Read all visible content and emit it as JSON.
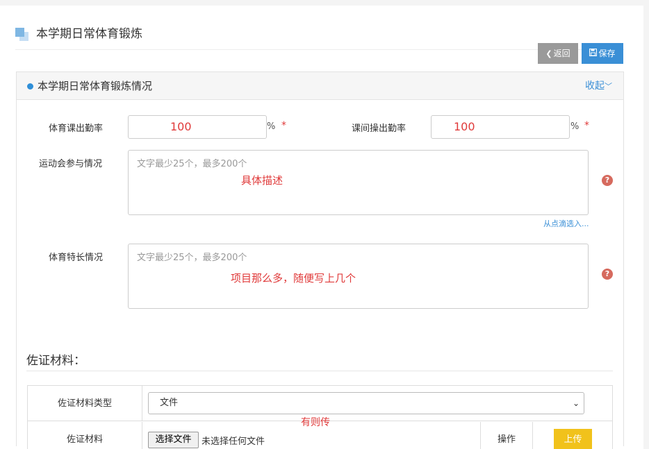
{
  "header": {
    "title": "本学期日常体育锻炼",
    "back_label": "返回",
    "save_label": "保存"
  },
  "panel": {
    "title": "本学期日常体育锻炼情况",
    "collapse_label": "收起",
    "fields": {
      "pe_attendance": {
        "label": "体育课出勤率",
        "value": "100",
        "unit": "%",
        "required": "*"
      },
      "exercise_attendance": {
        "label": "课间操出勤率",
        "value": "100",
        "unit": "%",
        "required": "*"
      },
      "sports_meet": {
        "label": "运动会参与情况",
        "placeholder": "文字最少25个，最多200个",
        "note": "具体描述",
        "pick_link": "从点滴选入..."
      },
      "sports_specialty": {
        "label": "体育特长情况",
        "placeholder": "文字最少25个，最多200个",
        "note": "项目那么多，随便写上几个"
      }
    }
  },
  "evidence": {
    "section_title": "佐证材料：",
    "type_label": "佐证材料类型",
    "type_selected": "文件",
    "material_label": "佐证材料",
    "choose_file_label": "选择文件",
    "no_file_label": "未选择任何文件",
    "operation_label": "操作",
    "upload_label": "上传",
    "note": "有则传"
  },
  "icons": {
    "back": "chevron-left-icon",
    "save": "floppy-icon",
    "help": "question-circle-icon",
    "collapse": "chevron-down-icon"
  },
  "colors": {
    "accent": "#3a8fd6",
    "annotation": "#e03a3a",
    "upload": "#f1c21b",
    "back_button": "#9a9a9a"
  }
}
